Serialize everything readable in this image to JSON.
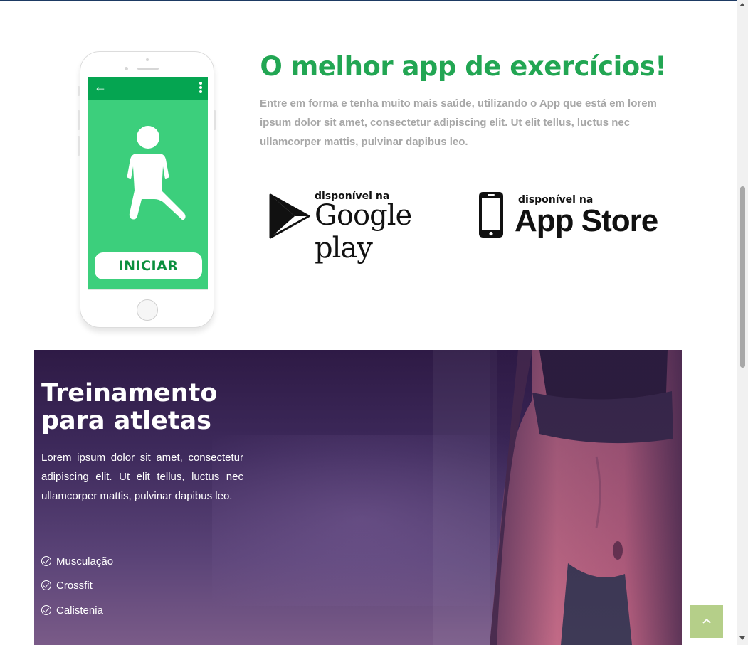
{
  "app_section": {
    "title": "O melhor app de exercícios!",
    "description": "Entre em forma e tenha muito mais saúde, utilizando o App que está em lorem ipsum dolor sit amet, consectetur adipiscing elit. Ut elit tellus, luctus nec ullamcorper mattis, pulvinar dapibus leo.",
    "phone": {
      "back_glyph": "←",
      "start_button": "INICIAR"
    },
    "google_play": {
      "small": "disponível na",
      "big": "Google play"
    },
    "app_store": {
      "small": "disponível na",
      "big": "App Store"
    }
  },
  "hero": {
    "title_line1": "Treinamento",
    "title_line2": "para atletas",
    "text": "Lorem ipsum dolor sit amet, consectetur adipiscing elit. Ut elit tellus, luctus nec ullamcorper mattis, pulvinar dapibus leo.",
    "features": [
      "Musculação",
      "Crossfit",
      "Calistenia"
    ]
  },
  "back_to_top": {
    "icon": "chevron-up-icon",
    "glyph": "˄"
  },
  "colors": {
    "accent": "#22a653",
    "phone_screen": "#3ccf7c",
    "back_to_top": "#b5cf89"
  }
}
